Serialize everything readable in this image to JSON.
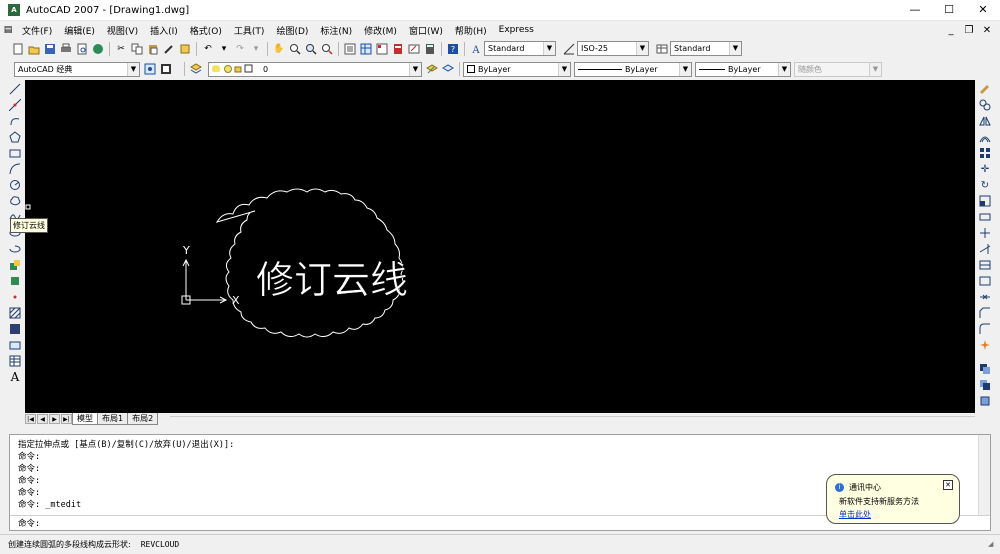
{
  "window": {
    "title": "AutoCAD 2007 - [Drawing1.dwg]",
    "controls": [
      "—",
      "☐",
      "✕"
    ],
    "mdi_controls": [
      "_",
      "❐",
      "✕"
    ]
  },
  "menu": [
    "文件(F)",
    "编辑(E)",
    "视图(V)",
    "插入(I)",
    "格式(O)",
    "工具(T)",
    "绘图(D)",
    "标注(N)",
    "修改(M)",
    "窗口(W)",
    "帮助(H)",
    "Express"
  ],
  "toolbar1": {
    "text_style": "Standard",
    "dim_style": "ISO-25",
    "table_style": "Standard"
  },
  "toolbar2": {
    "workspace": "AutoCAD 经典",
    "layer": "0",
    "color": "ByLayer",
    "linetype": "ByLayer",
    "lineweight": "ByLayer",
    "plotstyle": "随颜色"
  },
  "tooltip": "修订云线",
  "canvas": {
    "cloud_text": "修订云线",
    "ucs_x": "X",
    "ucs_y": "Y"
  },
  "layout_tabs": [
    "模型",
    "布局1",
    "布局2"
  ],
  "command": {
    "history": [
      "指定拉伸点或 [基点(B)/复制(C)/放弃(U)/退出(X)]:",
      "命令:",
      "命令:",
      "命令:",
      "命令:",
      "命令: _mtedit"
    ],
    "prompt": "命令:"
  },
  "status": {
    "description": "创建连续圆弧的多段线构成云形状:",
    "command": "REVCLOUD"
  },
  "notification": {
    "title": "通讯中心",
    "body": "新软件支持新服务方法",
    "link": "单击此处"
  }
}
